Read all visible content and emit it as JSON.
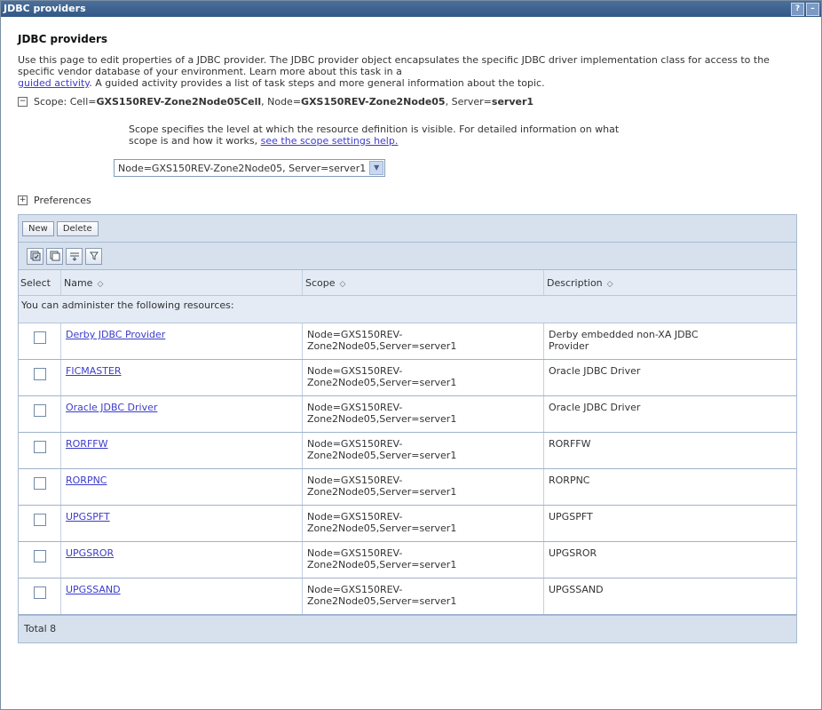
{
  "window": {
    "title": "JDBC providers",
    "help": "?",
    "minimize": "–"
  },
  "page": {
    "heading": "JDBC providers",
    "intro_text": "Use this page to edit properties of a JDBC provider. The JDBC provider object encapsulates the specific JDBC driver implementation class for access to the specific vendor database of your environment. Learn more about this task in a",
    "intro_link": "guided activity",
    "intro_tail": ". A guided activity provides a list of task steps and more general information about the topic."
  },
  "scope": {
    "toggle": "−",
    "label": "Scope: Cell=",
    "cell": "GXS150REV-Zone2Node05Cell",
    "node_label": ", Node=",
    "node": "GXS150REV-Zone2Node05",
    "server_label": ", Server=",
    "server": "server1",
    "help_text": "Scope specifies the level at which the resource definition is visible. For detailed information on what scope is and how it works,",
    "help_link": "see the scope settings help.",
    "selected": "Node=GXS150REV-Zone2Node05, Server=server1"
  },
  "preferences": {
    "toggle": "+",
    "label": "Preferences"
  },
  "toolbar": {
    "new": "New",
    "delete": "Delete"
  },
  "table": {
    "columns": {
      "select": "Select",
      "name": "Name",
      "scope": "Scope",
      "description": "Description"
    },
    "caption": "You can administer the following resources:",
    "rows": [
      {
        "name": "Derby JDBC Provider",
        "scope1": "Node=GXS150REV-",
        "scope2": "Zone2Node05,Server=server1",
        "description": "Derby embedded non-XA JDBC Provider"
      },
      {
        "name": "FICMASTER",
        "scope1": "Node=GXS150REV-",
        "scope2": "Zone2Node05,Server=server1",
        "description": "Oracle JDBC Driver"
      },
      {
        "name": "Oracle JDBC Driver",
        "scope1": "Node=GXS150REV-",
        "scope2": "Zone2Node05,Server=server1",
        "description": "Oracle JDBC Driver"
      },
      {
        "name": "RORFFW",
        "scope1": "Node=GXS150REV-",
        "scope2": "Zone2Node05,Server=server1",
        "description": "RORFFW"
      },
      {
        "name": "RORPNC",
        "scope1": "Node=GXS150REV-",
        "scope2": "Zone2Node05,Server=server1",
        "description": "RORPNC"
      },
      {
        "name": "UPGSPFT",
        "scope1": "Node=GXS150REV-",
        "scope2": "Zone2Node05,Server=server1",
        "description": "UPGSPFT"
      },
      {
        "name": "UPGSROR",
        "scope1": "Node=GXS150REV-",
        "scope2": "Zone2Node05,Server=server1",
        "description": "UPGSROR"
      },
      {
        "name": "UPGSSAND",
        "scope1": "Node=GXS150REV-",
        "scope2": "Zone2Node05,Server=server1",
        "description": "UPGSSAND"
      }
    ],
    "total": "Total 8"
  }
}
